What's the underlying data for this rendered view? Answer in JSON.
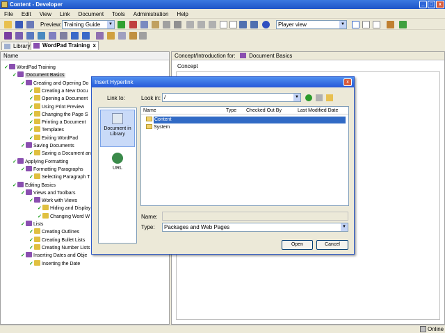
{
  "window": {
    "title": "Content - Developer"
  },
  "menu": [
    "File",
    "Edit",
    "View",
    "Link",
    "Document",
    "Tools",
    "Administration",
    "Help"
  ],
  "toolbar": {
    "preview_label": "Preview:",
    "preview_value": "Training Guide",
    "view_value": "Player view"
  },
  "tabs": [
    {
      "label": "Library"
    },
    {
      "label": "WordPad Training"
    }
  ],
  "left_pane": {
    "header": "Name"
  },
  "tree": [
    {
      "label": "WordPad Training",
      "check": "✓",
      "icon": "module-icon"
    },
    {
      "label": "Document Basics",
      "check": "✓",
      "icon": "section-icon",
      "selected": true
    },
    {
      "label": "Creating and Opening Do",
      "check": "✓",
      "icon": "section-icon"
    },
    {
      "label": "Creating a New Docu",
      "check": "✓",
      "icon": "topic-icon"
    },
    {
      "label": "Opening a Document",
      "check": "✓",
      "icon": "topic-icon"
    },
    {
      "label": "Using Print Preview",
      "check": "✓",
      "icon": "topic-icon"
    },
    {
      "label": "Changing the Page S",
      "check": "✓",
      "icon": "topic-icon"
    },
    {
      "label": "Printing a Document",
      "check": "✓",
      "icon": "topic-icon"
    },
    {
      "label": "Templates",
      "check": "✓",
      "icon": "topic-icon"
    },
    {
      "label": "Exiting WordPad",
      "check": "✓",
      "icon": "topic-icon"
    },
    {
      "label": "Saving Documents",
      "check": "✓",
      "icon": "section-icon"
    },
    {
      "label": "Saving a Document an",
      "check": "✓",
      "icon": "topic-icon"
    },
    {
      "label": "Applying Formatting",
      "check": "✓",
      "icon": "section-icon"
    },
    {
      "label": "Formatting Paragraphs",
      "check": "✓",
      "icon": "section-icon"
    },
    {
      "label": "Selecting Paragraph T",
      "check": "✓",
      "icon": "topic-icon"
    },
    {
      "label": "Editing Basics",
      "check": "✓",
      "icon": "section-icon"
    },
    {
      "label": "Views and Toolbars",
      "check": "✓",
      "icon": "section-icon"
    },
    {
      "label": "Work with Views",
      "check": "✓",
      "icon": "section-icon"
    },
    {
      "label": "Hiding and Display",
      "check": "✓",
      "icon": "topic-icon"
    },
    {
      "label": "Changing Word W",
      "check": "✓",
      "icon": "topic-icon"
    },
    {
      "label": "Lists",
      "check": "✓",
      "icon": "section-icon"
    },
    {
      "label": "Creating Outlines",
      "check": "✓",
      "icon": "topic-icon"
    },
    {
      "label": "Creating Bullet Lists",
      "check": "✓",
      "icon": "topic-icon"
    },
    {
      "label": "Creating Number Lists",
      "check": "✓",
      "icon": "topic-icon"
    },
    {
      "label": "Inserting Dates and Obje",
      "check": "✓",
      "icon": "section-icon"
    },
    {
      "label": "Inserting the Date",
      "check": "✓",
      "icon": "topic-icon"
    }
  ],
  "right_pane": {
    "header_prefix": "Concept/Introduction for:",
    "header_doc": "Document Basics",
    "concept_label": "Concept"
  },
  "dialog": {
    "title": "Insert Hyperlink",
    "close": "x",
    "link_to_label": "Link to:",
    "look_in_label": "Look in:",
    "look_in_value": "/",
    "places": [
      {
        "label": "Document in Library",
        "selected": true
      },
      {
        "label": "URL"
      }
    ],
    "columns": [
      "Name",
      "Type",
      "Checked Out By",
      "Last Modified Date"
    ],
    "files": [
      {
        "name": "Content",
        "selected": true
      },
      {
        "name": "System"
      }
    ],
    "name_label": "Name:",
    "name_value": "",
    "type_label": "Type:",
    "type_value": "Packages and Web Pages",
    "open_label": "Open",
    "cancel_label": "Cancel"
  },
  "status": {
    "online": "Online"
  }
}
